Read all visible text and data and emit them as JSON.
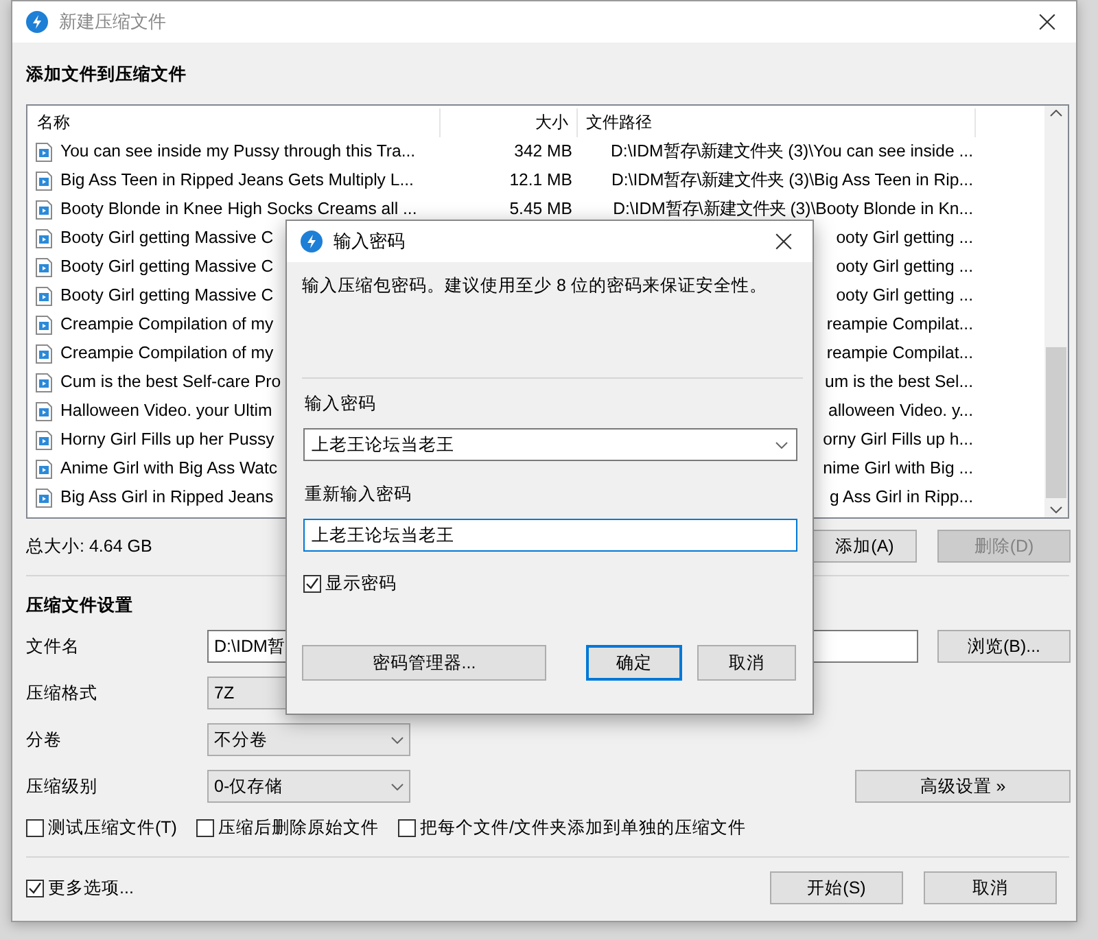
{
  "window": {
    "title": "新建压缩文件"
  },
  "files_section": {
    "heading": "添加文件到压缩文件",
    "columns": [
      "名称",
      "大小",
      "文件路径"
    ],
    "rows": [
      {
        "name": "You can see inside my Pussy through this Tra...",
        "size": "342 MB",
        "path": "D:\\IDM暂存\\新建文件夹 (3)\\You can see inside ..."
      },
      {
        "name": "Big Ass Teen in Ripped Jeans Gets Multiply L...",
        "size": "12.1 MB",
        "path": "D:\\IDM暂存\\新建文件夹 (3)\\Big Ass Teen in Rip..."
      },
      {
        "name": "Booty Blonde in Knee High Socks Creams all ...",
        "size": "5.45 MB",
        "path": "D:\\IDM暂存\\新建文件夹 (3)\\Booty Blonde in Kn..."
      },
      {
        "name": "Booty Girl getting Massive C",
        "path": "ooty Girl getting ..."
      },
      {
        "name": "Booty Girl getting Massive C",
        "path": "ooty Girl getting ..."
      },
      {
        "name": "Booty Girl getting Massive C",
        "path": "ooty Girl getting ..."
      },
      {
        "name": "Creampie Compilation of my",
        "path": "reampie Compilat..."
      },
      {
        "name": "Creampie Compilation of my",
        "path": "reampie Compilat..."
      },
      {
        "name": "Cum is the best Self-care Pro",
        "path": "um is the best Sel..."
      },
      {
        "name": "Halloween Video. your Ultim",
        "path": "alloween Video. y..."
      },
      {
        "name": "Horny Girl Fills up her Pussy",
        "path": "orny Girl Fills up h..."
      },
      {
        "name": "Anime Girl with Big Ass Watc",
        "path": "nime Girl with Big ..."
      },
      {
        "name": "Big Ass Girl in Ripped Jeans",
        "path": "g Ass Girl in Ripp..."
      }
    ]
  },
  "total_size": "总大小: 4.64 GB",
  "list_buttons": [
    {
      "label": "添加(A)",
      "disabled": false
    },
    {
      "label": "删除(D)",
      "disabled": true
    }
  ],
  "settings": {
    "heading": "压缩文件设置",
    "rows": [
      {
        "label": "文件名",
        "kind": "field",
        "value": "D:\\IDM暂"
      },
      {
        "label": "压缩格式",
        "kind": "plain",
        "value": "7Z"
      },
      {
        "label": "分卷",
        "kind": "select",
        "value": "不分卷"
      },
      {
        "label": "压缩级别",
        "kind": "select",
        "value": "0-仅存储"
      }
    ],
    "browse_button": "浏览(B)...",
    "advanced_button": "高级设置 »"
  },
  "options": [
    {
      "label": "测试压缩文件(T)",
      "checked": false
    },
    {
      "label": "压缩后删除原始文件",
      "checked": false
    },
    {
      "label": "把每个文件/文件夹添加到单独的压缩文件",
      "checked": false
    }
  ],
  "more_options": {
    "label": "更多选项...",
    "checked": true
  },
  "footer_buttons": [
    "开始(S)",
    "取消"
  ],
  "password_dialog": {
    "title": "输入密码",
    "description": "输入压缩包密码。建议使用至少 8 位的密码来保证安全性。",
    "password_label": "输入密码",
    "password": "上老王论坛当老王",
    "confirm_label": "重新输入密码",
    "confirm": "上老王论坛当老王",
    "show_password": {
      "label": "显示密码",
      "checked": true
    },
    "buttons": [
      {
        "label": "密码管理器...",
        "default": false
      },
      {
        "label": "确定",
        "default": true
      },
      {
        "label": "取消",
        "default": false
      }
    ]
  }
}
